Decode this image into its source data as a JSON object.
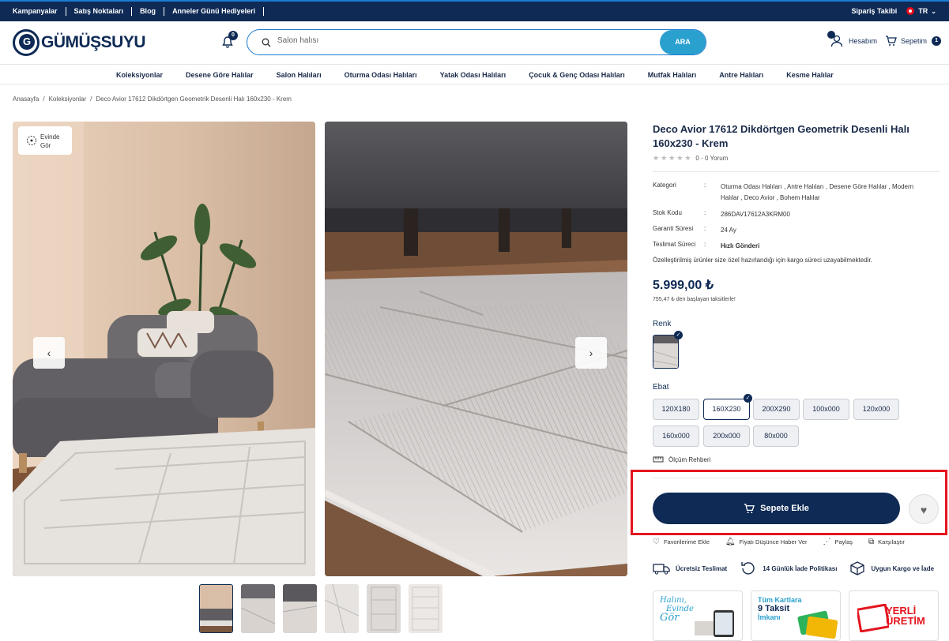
{
  "topbar": {
    "links": [
      "Kampanyalar",
      "Satış Noktaları",
      "Blog",
      "Anneler Günü Hediyeleri"
    ],
    "order_tracking": "Sipariş Takibi",
    "language": "TR"
  },
  "header": {
    "logo_text": "GÜMÜŞSUYU",
    "notification_count": "0",
    "search_placeholder": "Salon halısı",
    "search_button": "ARA",
    "account_label": "Hesabım",
    "cart_label": "Sepetim",
    "cart_count": "1"
  },
  "nav": {
    "items": [
      "Koleksiyonlar",
      "Desene Göre Halılar",
      "Salon Halıları",
      "Oturma Odası Halıları",
      "Yatak Odası Halıları",
      "Çocuk & Genç Odası Halıları",
      "Mutfak Halıları",
      "Antre Halıları",
      "Kesme Halılar"
    ]
  },
  "breadcrumb": [
    "Anasayfa",
    "Koleksiyonlar",
    "Deco Avior 17612 Dikdörtgen Geometrik Desenli Halı 160x230 - Krem"
  ],
  "gallery": {
    "badge_label": "Evinde Gör",
    "prev_icon": "‹",
    "next_icon": "›"
  },
  "product": {
    "title": "Deco Avior 17612 Dikdörtgen Geometrik Desenli Halı 160x230 - Krem",
    "rating_stars": 0,
    "review_text": "0 - 0 Yorum",
    "specs": [
      {
        "key": "Kategori",
        "value": "Oturma Odası Halıları , Antre Halıları , Desene Göre Halılar , Modern Halılar , Deco Avior , Bohem Halılar"
      },
      {
        "key": "Stok Kodu",
        "value": "286DAV17612A3KRM00"
      },
      {
        "key": "Garanti Süresi",
        "value": "24 Ay"
      },
      {
        "key": "Teslimat Süreci",
        "value": "Hızlı Gönderi"
      }
    ],
    "custom_note": "Özelleştirilmiş ürünler size özel hazırlandığı için kargo süreci uzayabilmektedir.",
    "price": "5.999,00 ₺",
    "installment": "755,47 ₺ den başlayan taksitlerle!",
    "color_label": "Renk",
    "size_label": "Ebat",
    "sizes": [
      "120X180",
      "160X230",
      "200X290",
      "100x000",
      "120x000",
      "160x000",
      "200x000",
      "80x000"
    ],
    "selected_size": "160X230",
    "size_guide": "Ölçüm Rehberi",
    "add_to_cart": "Sepete Ekle",
    "actions": [
      "Favorilerime Ekle",
      "Fiyatı Düşünce Haber Ver",
      "Paylaş",
      "Karşılaştır"
    ],
    "features": [
      "Ücretsiz Teslimat",
      "14 Günlük İade Politikası",
      "Uygun Kargo ve İade"
    ],
    "banners": [
      {
        "line1": "Halını,",
        "line2": "Evinde",
        "line3": "Gör"
      },
      {
        "line1": "Tüm Kartlara",
        "line2": "9 Taksit",
        "line3": "İmkanı"
      },
      {
        "line1": "YERLİ",
        "line2": "ÜRETİM",
        "line3": ""
      }
    ]
  },
  "colors": {
    "navy": "#0e2a55",
    "accent": "#2aa0cf",
    "highlight": "#e4151f"
  }
}
